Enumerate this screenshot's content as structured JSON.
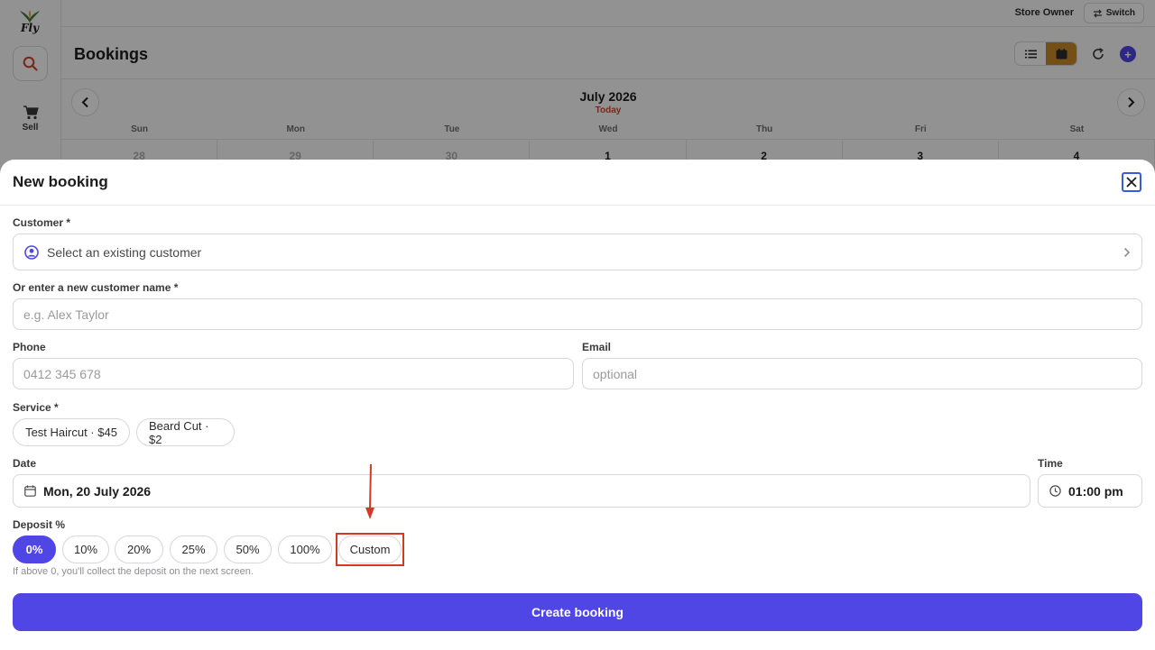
{
  "brand": {
    "logo_text": "Fly"
  },
  "sidebar": {
    "search_icon": "search-icon",
    "items": [
      {
        "label": "Sell",
        "icon": "cart-icon"
      }
    ]
  },
  "topbar": {
    "user_role": "Store Owner",
    "switch_label": "Switch"
  },
  "page": {
    "title": "Bookings",
    "view_modes": [
      {
        "icon": "list-icon",
        "active": false
      },
      {
        "icon": "calendar-icon",
        "active": true
      }
    ]
  },
  "calendar": {
    "month": "July 2026",
    "today_label": "Today",
    "weekdays": [
      "Sun",
      "Mon",
      "Tue",
      "Wed",
      "Thu",
      "Fri",
      "Sat"
    ],
    "dates": [
      "28",
      "29",
      "30",
      "1",
      "2",
      "3",
      "4"
    ]
  },
  "modal": {
    "title": "New booking",
    "customer": {
      "label": "Customer *",
      "select_text": "Select an existing customer"
    },
    "new_customer": {
      "label": "Or enter a new customer name *",
      "placeholder": "e.g. Alex Taylor"
    },
    "phone": {
      "label": "Phone",
      "placeholder": "0412 345 678"
    },
    "email": {
      "label": "Email",
      "placeholder": "optional"
    },
    "service": {
      "label": "Service *",
      "options": [
        "Test Haircut · $45",
        "Beard Cut · $2"
      ]
    },
    "date": {
      "label": "Date",
      "value": "Mon, 20 July 2026"
    },
    "time": {
      "label": "Time",
      "value": "01:00 pm"
    },
    "deposit": {
      "label": "Deposit %",
      "options": [
        "0%",
        "10%",
        "20%",
        "25%",
        "50%",
        "100%",
        "Custom"
      ],
      "selected": "0%",
      "hint": "If above 0, you'll collect the deposit on the next screen."
    },
    "submit_label": "Create booking"
  },
  "colors": {
    "accent": "#4f46e5",
    "calendar_active": "#c98a2a",
    "today": "#d0452a",
    "annotation": "#d33a26"
  }
}
